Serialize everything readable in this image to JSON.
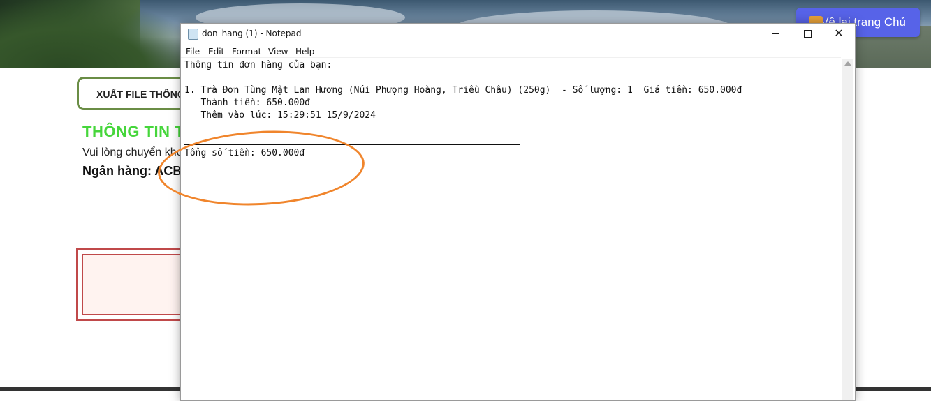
{
  "background_page": {
    "home_button": "Về lại trang Chủ",
    "export_button": "XUẤT FILE THÔNG",
    "info_title": "THÔNG TIN T",
    "transfer_text": "Vui lòng chuyển kho",
    "bank_label": "Ngân hàng:",
    "bank_value": "ACB"
  },
  "notepad": {
    "title": "don_hang (1) - Notepad",
    "menu": [
      "File",
      "Edit",
      "Format",
      "View",
      "Help"
    ],
    "lines": [
      "Thông tin đơn hàng của bạn:",
      "1. Trà Đơn Tùng Mật Lan Hương (Núi Phượng Hoàng, Triều Châu) (250g)  - Số lượng: 1  Giá tiền: 650.000đ",
      "   Thành tiền: 650.000đ",
      "   Thêm vào lúc: 15:29:51 15/9/2024",
      "Tổng số tiền: 650.000đ"
    ]
  },
  "colors": {
    "home_button_bg": "#5763e8",
    "info_title": "#46d63b",
    "annotation_circle": "#f0852c",
    "red_box": "#c0494a"
  }
}
